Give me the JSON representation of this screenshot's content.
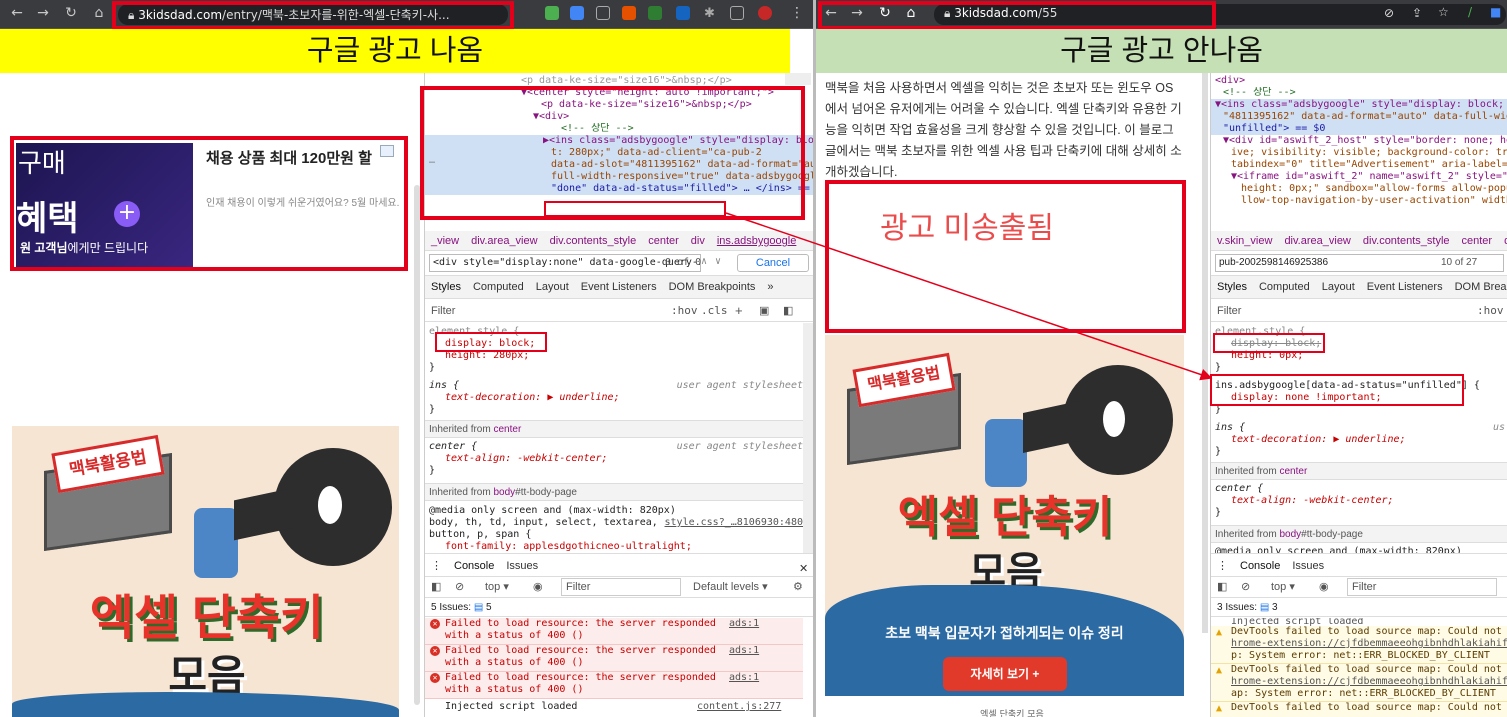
{
  "left": {
    "url_host": "3kidsdad.com",
    "url_path": "/entry/맥북-초보자를-위한-엑셀-단축키-사...",
    "banner": "구글 광고 나옴",
    "ad": {
      "text_buy": "구매",
      "text_benefit": "혜택",
      "text_bottom_bold": "원 고객님",
      "text_bottom": "에게만 드립니다",
      "headline": "채용 상품 최대 120만원 할",
      "body": "인재 채용이 이렇게 쉬운거였어요? 5월 마세요."
    },
    "creative": {
      "label": "맥북활용법",
      "title1": "엑셀 단축키",
      "title2": "모음"
    },
    "devtools": {
      "dom": [
        "<p data-ke-size=\"size16\">&nbsp;</p>",
        "▼<center style=\"height: auto !important;\">",
        "<p data-ke-size=\"size16\">&nbsp;</p>",
        "▼<div>",
        "<!-- 상단 -->",
        "▶<ins class=\"adsbygoogle\" style=\"display: block",
        "t: 280px;\" data-ad-client=\"ca-pub-2",
        "data-ad-slot=\"4811395162\" data-ad-format=\"auto",
        "full-width-responsive=\"true\" data-adsbygoogle",
        "\"done\" data-ad-status=\"filled\"> … </ins> == $0"
      ],
      "crumbs": [
        "_view",
        "div.area_view",
        "div.contents_style",
        "center",
        "div",
        "ins.adsbygoogle"
      ],
      "search_value": "<div style=\"display:none\" data-google-query-i",
      "search_count": "0 of 0",
      "cancel": "Cancel",
      "tabs": [
        "Styles",
        "Computed",
        "Layout",
        "Event Listeners",
        "DOM Breakpoints",
        "»"
      ],
      "filter_placeholder": "Filter",
      "hov": ":hov",
      "cls": ".cls",
      "css": {
        "element_style": "element.style {",
        "display": "display: block;",
        "height": "height: 280px;",
        "close": "}",
        "ins_rule": "ins {",
        "ins_src": "user agent stylesheet",
        "ins_prop": "text-decoration: ▶ underline;",
        "inh_center_pre": "Inherited from ",
        "inh_center": "center",
        "center_rule": "center {",
        "center_src": "user agent stylesheet",
        "center_prop": "text-align: -webkit-center;",
        "inh_body_pre": "Inherited from ",
        "inh_body": "body",
        "inh_body_suf": "#tt-body-page",
        "media": "@media only screen and (max-width: 820px)",
        "media_sel": "body, th, td, input, select, textarea,",
        "media_sel2": "button, p, span {",
        "media_src": "style.css?_…8106930:480",
        "media_prop": "font-family: applesdgothicneo-ultralight;"
      },
      "console_tabs": [
        "Console",
        "Issues"
      ],
      "top": "top ▾",
      "console_filter": "Filter",
      "levels": "Default levels ▾",
      "issues": "5 Issues:",
      "issues_count": "5",
      "errors": [
        {
          "text": "Failed to load resource: the server responded with a status of 400 ()",
          "src": "ads:1"
        },
        {
          "text": "Failed to load resource: the server responded with a status of 400 ()",
          "src": "ads:1"
        },
        {
          "text": "Failed to load resource: the server responded with a status of 400 ()",
          "src": "ads:1"
        }
      ],
      "injected": "Injected script loaded",
      "injected_src": "content.js:277"
    }
  },
  "right": {
    "url_host": "3kidsdad.com",
    "url_path": "/55",
    "banner": "구글 광고 안나옴",
    "article": "맥북을 처음 사용하면서 엑셀을 익히는 것은 초보자 또는 윈도우 OS 에서 넘어온 유저에게는 어려울 수 있습니다. 엑셀 단축키와 유용한 기능을 익히면 작업 효율성을 크게 향상할 수 있을 것입니다. 이 블로그 글에서는 맥북 초보자를 위한 엑셀 사용 팁과 단축키에 대해 상세히 소개하겠습니다.",
    "not_served": "광고 미송출됨",
    "creative": {
      "label": "맥북활용법",
      "title1": "엑셀 단축키",
      "title2": "모음",
      "subtitle": "초보 맥북 입문자가 접하게되는 이슈 정리",
      "cta": "자세히 보기 +"
    },
    "caption": "엑셀 단축키 모음",
    "devtools": {
      "dom": [
        "<!-- 상단 -->",
        "▼<ins class=\"adsbygoogle\" style=\"display: block; hei",
        "\"4811395162\" data-ad-format=\"auto\" data-full-width-",
        "\"unfilled\"> == $0",
        "▼<div id=\"aswift_2_host\" style=\"border: none; heig",
        "ive; visibility: visible; background-color: trans",
        "tabindex=\"0\" title=\"Advertisement\" aria-label=\"Ac",
        "▼<iframe id=\"aswift_2\" name=\"aswift_2\" style=\"le",
        "height: 0px;\" sandbox=\"allow-forms allow-popups",
        "llow-top-navigation-by-user-activation\" width=\""
      ],
      "crumbs": [
        "v.skin_view",
        "div.area_view",
        "div.contents_style",
        "center",
        "d"
      ],
      "search_value": "pub-2002598146925386",
      "search_count": "10 of 27",
      "tabs": [
        "Styles",
        "Computed",
        "Layout",
        "Event Listeners",
        "DOM Break"
      ],
      "filter_placeholder": "Filter",
      "hov": ":hov",
      "css": {
        "element_style": "element.style {",
        "display": "display: block;",
        "height": "height: 0px;",
        "close": "}",
        "rule_sel": "ins.adsbygoogle[data-ad-status=\"unfilled\"] {",
        "rule_prop": "display: none !important;",
        "ins_rule": "ins {",
        "ins_src": "us",
        "ins_prop": "text-decoration: ▶ underline;",
        "inh_center_pre": "Inherited from ",
        "inh_center": "center",
        "center_rule": "center {",
        "center_prop": "text-align: -webkit-center;",
        "inh_body_pre": "Inherited from ",
        "inh_body": "body",
        "inh_body_suf": "#tt-body-page",
        "media": "@media only screen and (max-width: 820px)"
      },
      "console_tabs": [
        "Console",
        "Issues"
      ],
      "top": "top ▾",
      "console_filter": "Filter",
      "issues": "3 Issues:",
      "issues_count": "3",
      "injected": "Injected script loaded",
      "warnings": [
        {
          "l1": "DevTools failed to load source map: Could not loa",
          "l2": "hrome-extension://cjfdbemmaeeohgibnhdhlakiahifjjc",
          "l3": "p: System error: net::ERR_BLOCKED_BY_CLIENT"
        },
        {
          "l1": "DevTools failed to load source map: Could not loa",
          "l2": "hrome-extension://cjfdbemmaeeohgibnhdhlakiahifjjc",
          "l3": "ap: System error: net::ERR_BLOCKED_BY_CLIENT"
        },
        {
          "l1": "DevTools failed to load source map: Could not loa",
          "l2": "",
          "l3": ""
        }
      ]
    }
  },
  "colors": {
    "highlight_red": "#e4001b",
    "banner_left": "#ffff00",
    "banner_right": "#c5e0b4",
    "creative_bg": "#f6e5d3"
  }
}
